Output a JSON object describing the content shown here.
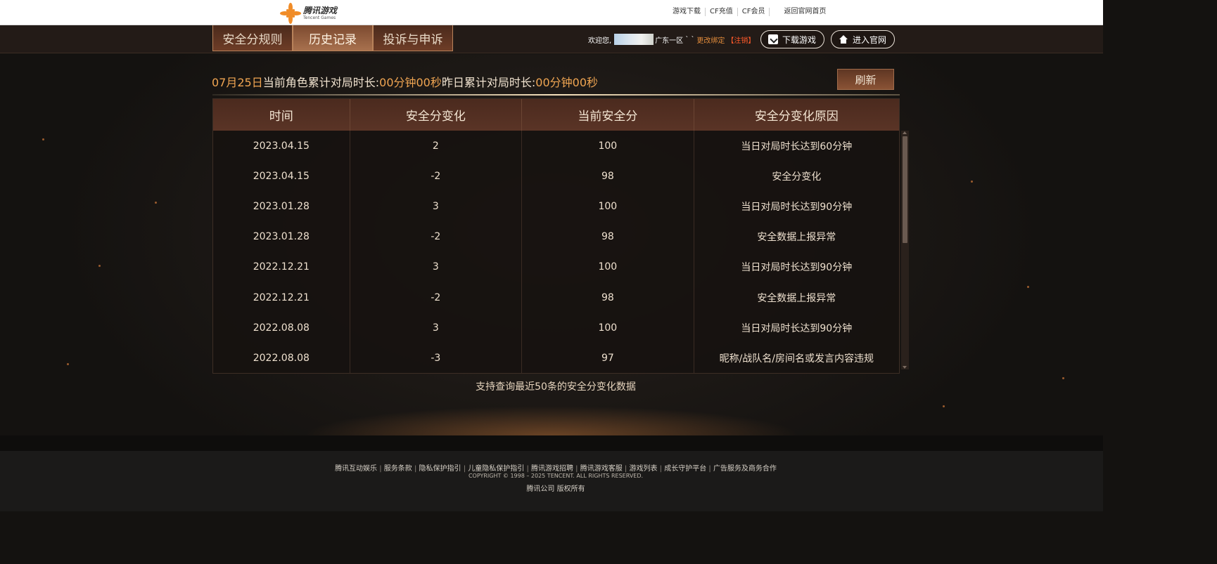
{
  "header": {
    "logo_cn": "腾讯游戏",
    "logo_en": "Tencent Games",
    "links": [
      "游戏下载",
      "CF充值",
      "CF会员"
    ],
    "home_link": "返回官网首页"
  },
  "nav": {
    "tabs": [
      {
        "label": "安全分规则",
        "active": false
      },
      {
        "label": "历史记录",
        "active": true
      },
      {
        "label": "投诉与申诉",
        "active": false
      }
    ],
    "welcome_prefix": "欢迎您,",
    "server": "广东一区",
    "server_suffix": "` `",
    "change_bind": "更改绑定",
    "logout": "【注销】",
    "download_button": "下载游戏",
    "site_button": "进入官网"
  },
  "stats": {
    "date": "07月25日",
    "today_label": "当前角色累计对局时长:",
    "today_value": "00分钟00秒",
    "yesterday_label": "昨日累计对局时长:",
    "yesterday_value": "00分钟00秒",
    "refresh_label": "刷新"
  },
  "table": {
    "headers": [
      "时间",
      "安全分变化",
      "当前安全分",
      "安全分变化原因"
    ],
    "rows": [
      [
        "2023.04.15",
        "2",
        "100",
        "当日对局时长达到60分钟"
      ],
      [
        "2023.04.15",
        "-2",
        "98",
        "安全分变化"
      ],
      [
        "2023.01.28",
        "3",
        "100",
        "当日对局时长达到90分钟"
      ],
      [
        "2023.01.28",
        "-2",
        "98",
        "安全数据上报异常"
      ],
      [
        "2022.12.21",
        "3",
        "100",
        "当日对局时长达到90分钟"
      ],
      [
        "2022.12.21",
        "-2",
        "98",
        "安全数据上报异常"
      ],
      [
        "2022.08.08",
        "3",
        "100",
        "当日对局时长达到90分钟"
      ],
      [
        "2022.08.08",
        "-3",
        "97",
        "昵称/战队名/房间名或发言内容违规"
      ]
    ],
    "note": "支持查询最近50条的安全分变化数据"
  },
  "footer": {
    "links": [
      "腾讯互动娱乐",
      "服务条款",
      "隐私保护指引",
      "儿童隐私保护指引",
      "腾讯游戏招聘",
      "腾讯游戏客服",
      "游戏列表",
      "成长守护平台",
      "广告服务及商务合作"
    ],
    "copyright": "COPYRIGHT © 1998 – 2025 TENCENT. ALL RIGHTS RESERVED.",
    "company": "腾讯公司 版权所有"
  },
  "colors": {
    "accent_orange": "#f0a552",
    "tab_active": "#a8714e",
    "logout_red": "#ff5a2a"
  }
}
